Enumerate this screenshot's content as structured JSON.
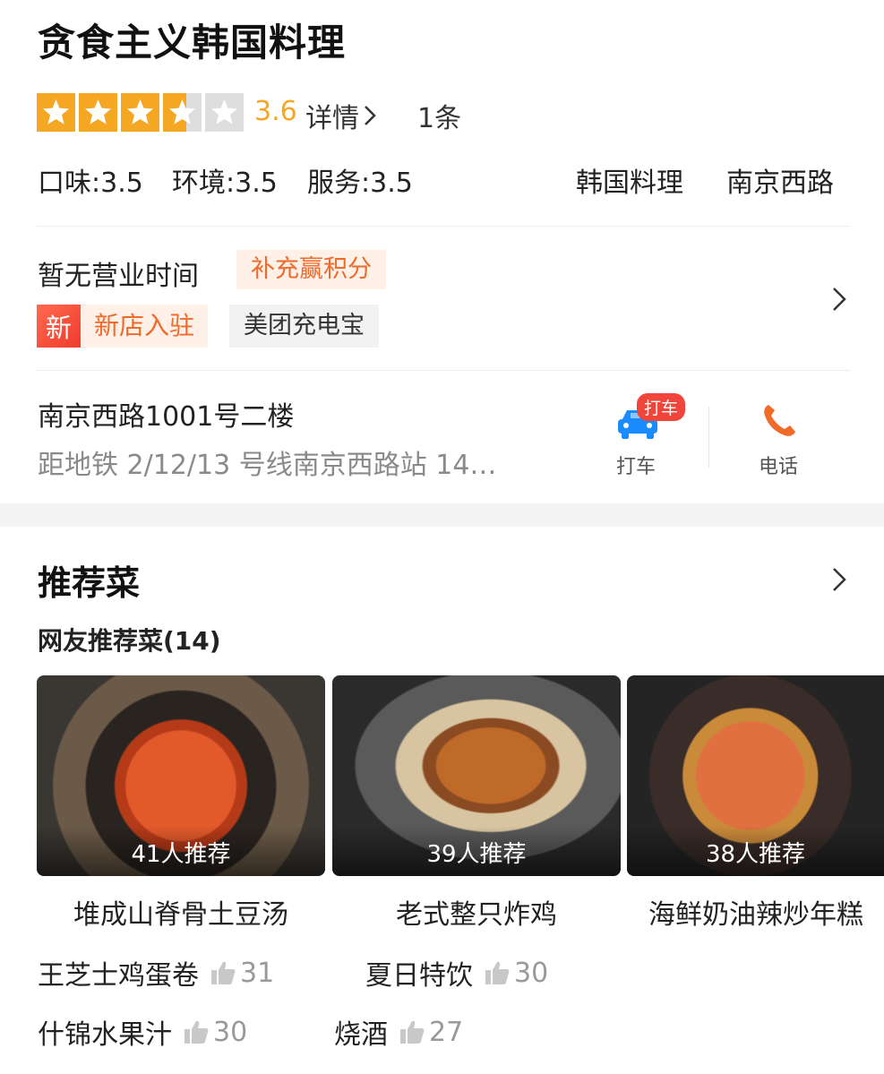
{
  "shop": {
    "name": "贪食主义韩国料理",
    "rating": 3.6,
    "rating_text": "3.6",
    "detail_label": "详情",
    "review_count": "1条",
    "scores": [
      {
        "text": "口味:3.5"
      },
      {
        "text": "环境:3.5"
      },
      {
        "text": "服务:3.5"
      }
    ],
    "category": "韩国料理",
    "district": "南京西路",
    "hours": "暂无营业时间",
    "points_badge": "补充赢积分",
    "new_badge_icon": "新",
    "new_badge_text": "新店入驻",
    "charge_badge": "美团充电宝",
    "address": "南京西路1001号二楼",
    "metro": "距地铁 2/12/13 号线南京西路站 14…",
    "taxi_badge": "打车",
    "taxi_label": "打车",
    "phone_label": "电话"
  },
  "recommend": {
    "title": "推荐菜",
    "subtitle": "网友推荐菜(14)",
    "dishes": [
      {
        "name": "堆成山脊骨土豆汤",
        "recommend": "41人推荐"
      },
      {
        "name": "老式整只炸鸡",
        "recommend": "39人推荐"
      },
      {
        "name": "海鲜奶油辣炒年糕",
        "recommend": "38人推荐"
      }
    ],
    "more": [
      {
        "name": "王芝士鸡蛋卷",
        "likes": "31"
      },
      {
        "name": "夏日特饮",
        "likes": "30"
      },
      {
        "name": "什锦水果汁",
        "likes": "30"
      },
      {
        "name": "烧酒",
        "likes": "27"
      }
    ]
  },
  "colors": {
    "star": "#f5a623",
    "accent": "#f06a2a",
    "new_red": "#ef3b2d",
    "taxi_blue": "#1a8cff"
  },
  "icons": [
    "star-icon",
    "chevron-right-icon",
    "taxi-icon",
    "phone-icon",
    "thumb-up-icon"
  ]
}
